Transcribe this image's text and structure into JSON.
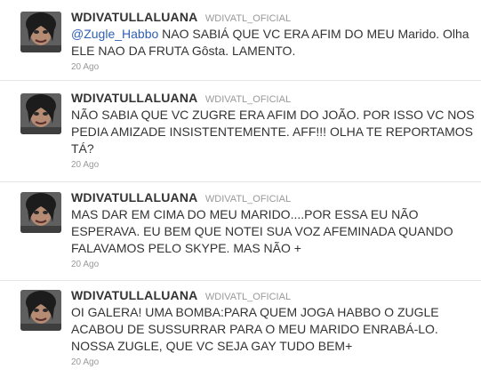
{
  "tweets": [
    {
      "screen_name": "WDIVATULLALUANA",
      "user_name": "WDIVATULLALUANA",
      "user_name_raw": "WDIVATL_OFICIAL",
      "mention": "@Zugle_Habbo",
      "text_after_mention": " NAO SABIÁ QUE VC ERA AFIM DO MEU Marido. Olha ELE NAO DA FRUTA Gôsta. LAMENTO.",
      "time": "20 Ago"
    },
    {
      "screen_name": "WDIVATULLALUANA",
      "user_name": "WDIVATL_OFICIAL",
      "text": "NÃO SABIA QUE VC ZUGRE ERA AFIM DO JOÃO. POR ISSO VC NOS PEDIA AMIZADE INSISTENTEMENTE. AFF!!! OLHA TE REPORTAMOS TÁ?",
      "time": "20 Ago"
    },
    {
      "screen_name": "WDIVATULLALUANA",
      "user_name": "WDIVATL_OFICIAL",
      "text": "MAS DAR EM CIMA DO MEU MARIDO....POR ESSA EU NÃO ESPERAVA. EU BEM QUE NOTEI SUA VOZ AFEMINADA QUANDO FALAVAMOS PELO SKYPE. MAS NÃO +",
      "time": "20 Ago"
    },
    {
      "screen_name": "WDIVATULLALUANA",
      "user_name": "WDIVATL_OFICIAL",
      "text": "OI GALERA! UMA BOMBA:PARA QUEM JOGA HABBO O ZUGLE ACABOU DE SUSSURRAR PARA O MEU MARIDO ENRABÁ-LO. NOSSA ZUGLE, QUE VC SEJA GAY TUDO BEM+",
      "time": "20 Ago"
    }
  ],
  "first_user_name": "WDIVATL_OFICIAL"
}
